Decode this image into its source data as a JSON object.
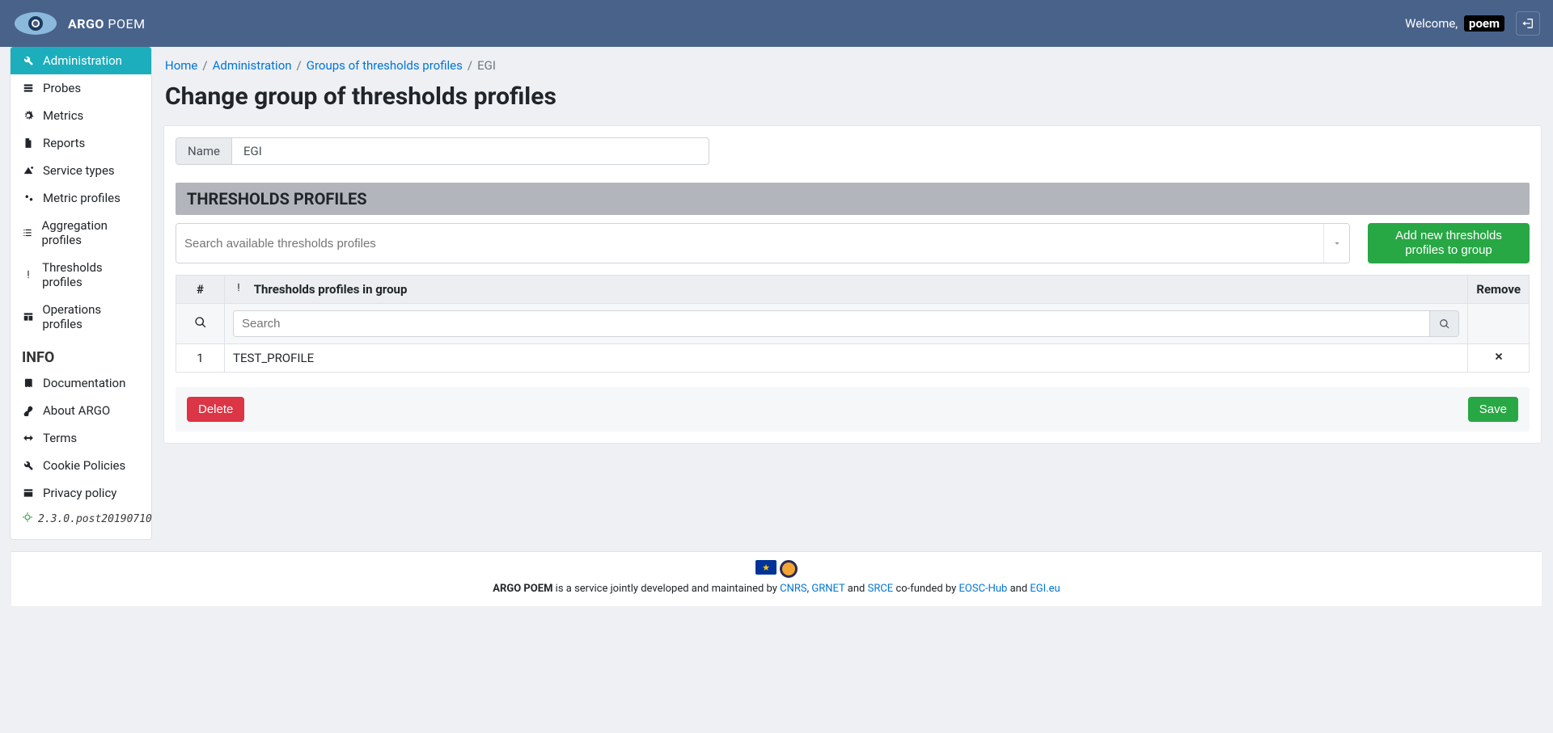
{
  "header": {
    "brand_strong": "ARGO",
    "brand_light": "POEM",
    "welcome_prefix": "Welcome,",
    "username": "poem"
  },
  "sidebar": {
    "items": [
      {
        "label": "Administration",
        "icon": "wrench-icon",
        "active": true
      },
      {
        "label": "Probes",
        "icon": "server-icon"
      },
      {
        "label": "Metrics",
        "icon": "cog-icon"
      },
      {
        "label": "Reports",
        "icon": "file-icon"
      },
      {
        "label": "Service types",
        "icon": "sign-icon"
      },
      {
        "label": "Metric profiles",
        "icon": "cogs-icon"
      },
      {
        "label": "Aggregation profiles",
        "icon": "list-icon"
      },
      {
        "label": "Thresholds profiles",
        "icon": "exclaim-icon"
      },
      {
        "label": "Operations profiles",
        "icon": "table-icon"
      }
    ],
    "info_header": "INFO",
    "info_items": [
      {
        "label": "Documentation",
        "icon": "book-icon"
      },
      {
        "label": "About ARGO",
        "icon": "link-icon"
      },
      {
        "label": "Terms",
        "icon": "hands-icon"
      },
      {
        "label": "Cookie Policies",
        "icon": "wrench-icon"
      },
      {
        "label": "Privacy policy",
        "icon": "window-icon"
      }
    ],
    "version": "2.3.0.post20190710"
  },
  "breadcrumb": {
    "items": [
      {
        "label": "Home",
        "link": true
      },
      {
        "label": "Administration",
        "link": true
      },
      {
        "label": "Groups of thresholds profiles",
        "link": true
      },
      {
        "label": "EGI",
        "link": false
      }
    ]
  },
  "page": {
    "title": "Change group of thresholds profiles",
    "name_label": "Name",
    "name_value": "EGI",
    "section_header": "THRESHOLDS PROFILES",
    "combo_placeholder": "Search available thresholds profiles",
    "add_button": "Add new thresholds profiles to group",
    "table": {
      "col_num": "#",
      "col_name": "Thresholds profiles in group",
      "col_remove": "Remove",
      "search_placeholder": "Search",
      "rows": [
        {
          "num": "1",
          "name": "TEST_PROFILE"
        }
      ]
    },
    "delete_button": "Delete",
    "save_button": "Save"
  },
  "footer": {
    "brand": "ARGO POEM",
    "line1": " is a service jointly developed and maintained by ",
    "cnrs": "CNRS",
    "grnet": "GRNET",
    "and": " and ",
    "srce": "SRCE",
    "cofunded": " co-funded by ",
    "eosc": "EOSC-Hub",
    "egi": "EGI.eu",
    "comma": ", "
  }
}
